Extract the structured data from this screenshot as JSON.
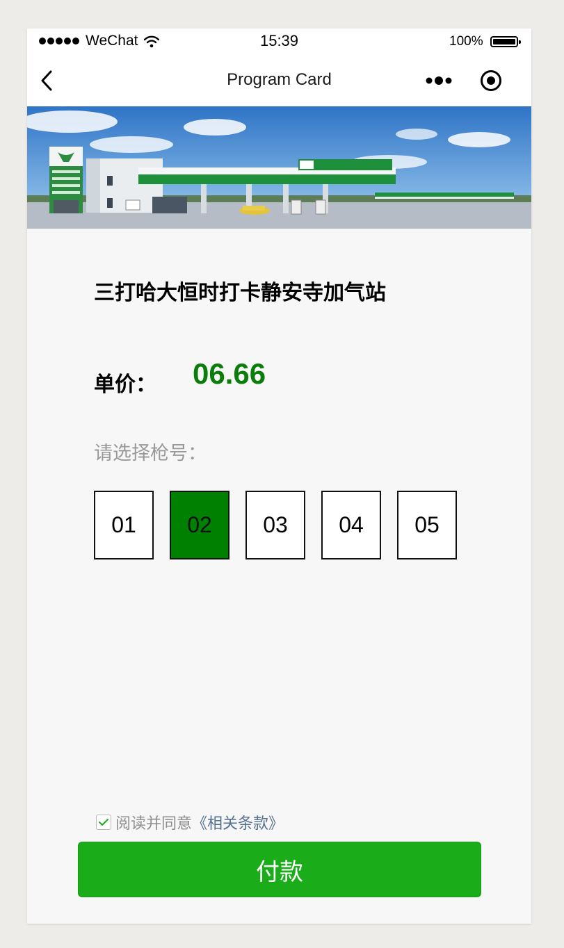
{
  "status_bar": {
    "carrier": "WeChat",
    "time": "15:39",
    "battery": "100%"
  },
  "nav": {
    "title": "Program Card"
  },
  "station": {
    "name": "三打哈大恒时打卡静安寺加气站"
  },
  "price": {
    "label": "单价：",
    "value": "06.66"
  },
  "nozzle_select": {
    "label": "请选择枪号：",
    "options": [
      "01",
      "02",
      "03",
      "04",
      "05"
    ],
    "selected": "02"
  },
  "agreement": {
    "checked": true,
    "text": "阅读并同意",
    "link": "《相关条款》"
  },
  "pay_button": {
    "label": "付款"
  },
  "colors": {
    "price": "#0a7d0a",
    "selected_nozzle": "#008000",
    "pay_button": "#1aad19",
    "terms_link": "#56708f"
  }
}
